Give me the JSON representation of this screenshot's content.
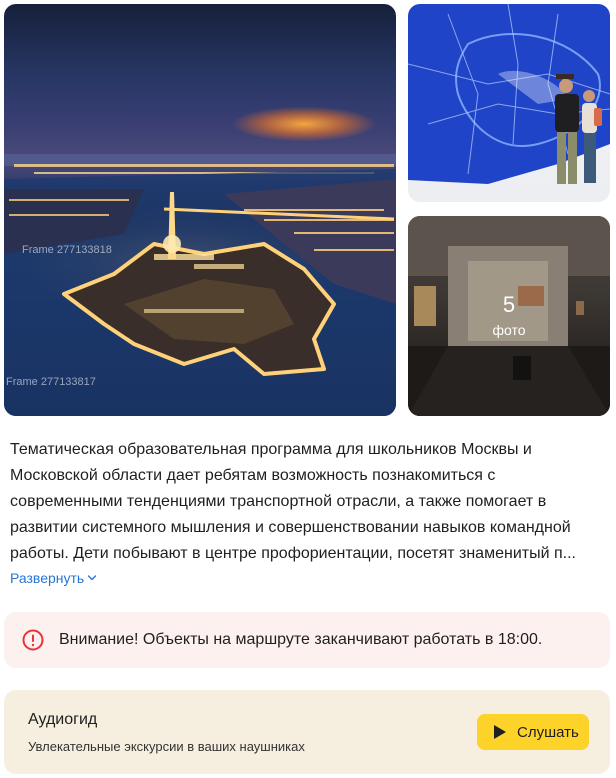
{
  "gallery": {
    "main_photo_label_1": "Frame 277133818",
    "main_photo_label_2": "Frame 277133817",
    "photo_count": "5",
    "photo_count_label": "фото"
  },
  "description": {
    "lines": [
      "Тематическая образовательная программа для школьников Москвы и",
      "Московской области дает ребятам возможность познакомиться с",
      "современными тенденциями транспортной отрасли, а также помогает в",
      "развитии системного мышления и совершенствовании навыков командной",
      "работы. Дети побывают в центре профориентации, посетят знаменитый п..."
    ],
    "expand_label": "Развернуть"
  },
  "warning": {
    "text": "Внимание! Объекты на маршруте заканчивают работать в 18:00.",
    "icon": "warning-circle-icon",
    "color": "#e8333b"
  },
  "audioguide": {
    "title": "Аудиогид",
    "subtitle": "Увлекательные экскурсии в ваших наушниках",
    "button_label": "Слушать",
    "button_color": "#fdd229",
    "icon": "play-icon"
  }
}
